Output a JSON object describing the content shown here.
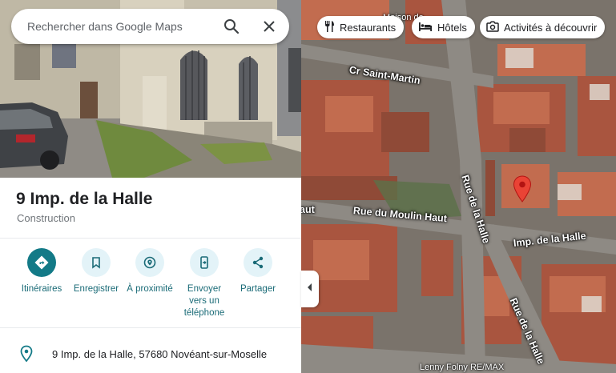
{
  "search": {
    "placeholder": "Rechercher dans Google Maps",
    "search_icon": "search-icon",
    "close_icon": "close-icon"
  },
  "place": {
    "title": "9 Imp. de la Halle",
    "category": "Construction"
  },
  "actions": [
    {
      "label": "Itinéraires",
      "icon": "directions-icon"
    },
    {
      "label": "Enregistrer",
      "icon": "bookmark-icon"
    },
    {
      "label": "À proximité",
      "icon": "nearby-icon"
    },
    {
      "label": "Envoyer vers un téléphone",
      "icon": "send-to-phone-icon"
    },
    {
      "label": "Partager",
      "icon": "share-icon"
    }
  ],
  "address": {
    "text": "9 Imp. de la Halle, 57680 Novéant-sur-Moselle",
    "icon": "location-pin-icon"
  },
  "chips": [
    {
      "label": "Restaurants",
      "icon": "restaurant-icon"
    },
    {
      "label": "Hôtels",
      "icon": "hotel-icon"
    },
    {
      "label": "Activités à découvrir",
      "icon": "camera-icon"
    }
  ],
  "map": {
    "streets": {
      "cr_saint_martin": "Cr Saint-Martin",
      "moulin_haut": "Rue du Moulin Haut",
      "moulin_haut_left": "aut",
      "rue_de_la_halle_top": "Rue de la Halle",
      "rue_de_la_halle_bottom": "Rue de la Halle",
      "imp_de_la_halle": "Imp. de la Halle"
    },
    "poi": {
      "lenny": "Lenny Folny RE/MAX",
      "maison_partial": "Maison de"
    }
  },
  "colors": {
    "accent": "#137a87",
    "action_bg": "#e3f3f8",
    "pin_red": "#ea4335",
    "action_text": "#1a6b77"
  }
}
